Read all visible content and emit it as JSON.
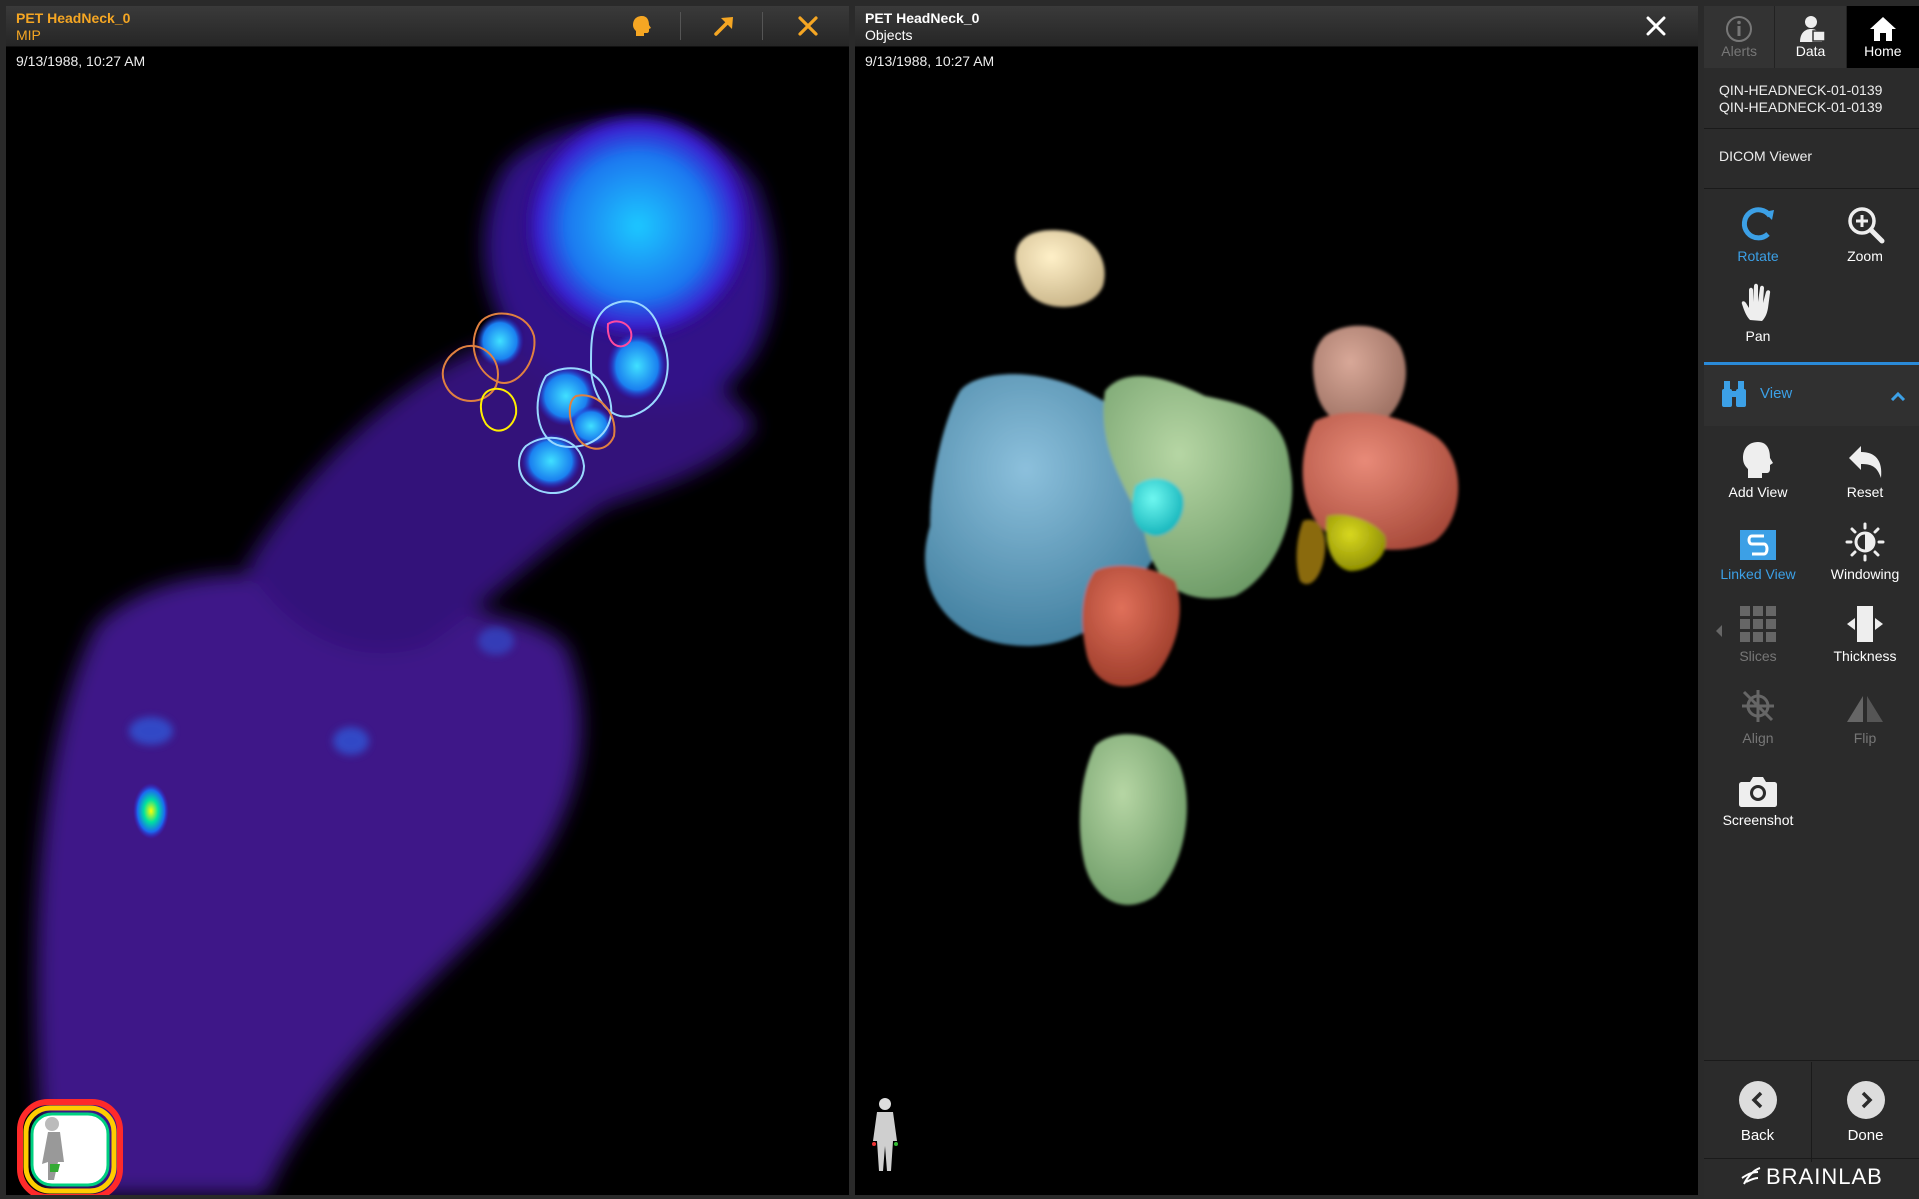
{
  "left_viewport": {
    "title": "PET HeadNeck_0",
    "subtitle": "MIP",
    "timestamp": "9/13/1988, 10:27 AM",
    "buttons": [
      "head-icon",
      "expand-arrow-icon",
      "close-icon"
    ]
  },
  "right_viewport": {
    "title": "PET HeadNeck_0",
    "subtitle": "Objects",
    "timestamp": "9/13/1988, 10:27 AM",
    "buttons": [
      "close-icon"
    ]
  },
  "sidebar": {
    "tabs": [
      {
        "label": "Alerts",
        "icon": "info-icon",
        "state": "disabled"
      },
      {
        "label": "Data",
        "icon": "data-icon",
        "state": "normal"
      },
      {
        "label": "Home",
        "icon": "home-icon",
        "state": "active"
      }
    ],
    "patient_line1": "QIN-HEADNECK-01-0139",
    "patient_line2": "QIN-HEADNECK-01-0139",
    "app_name": "DICOM Viewer",
    "tools_top": [
      {
        "label": "Rotate",
        "icon": "rotate-icon",
        "state": "active"
      },
      {
        "label": "Zoom",
        "icon": "zoom-icon",
        "state": "normal"
      },
      {
        "label": "Pan",
        "icon": "hand-icon",
        "state": "normal"
      }
    ],
    "view_section_label": "View",
    "tools_view": [
      {
        "label": "Add View",
        "icon": "head-icon",
        "state": "normal"
      },
      {
        "label": "Reset",
        "icon": "undo-icon",
        "state": "normal"
      },
      {
        "label": "Linked View",
        "icon": "link-icon",
        "state": "active"
      },
      {
        "label": "Windowing",
        "icon": "brightness-icon",
        "state": "normal"
      },
      {
        "label": "Slices",
        "icon": "grid-icon",
        "state": "disabled"
      },
      {
        "label": "Thickness",
        "icon": "thickness-icon",
        "state": "normal"
      },
      {
        "label": "Align",
        "icon": "align-icon",
        "state": "disabled"
      },
      {
        "label": "Flip",
        "icon": "flip-icon",
        "state": "disabled"
      },
      {
        "label": "Screenshot",
        "icon": "camera-icon",
        "state": "normal"
      }
    ],
    "back_label": "Back",
    "done_label": "Done",
    "brand": "BRAINLAB"
  },
  "colors": {
    "accent_orange": "#f5a623",
    "accent_blue": "#3ca0e6"
  }
}
